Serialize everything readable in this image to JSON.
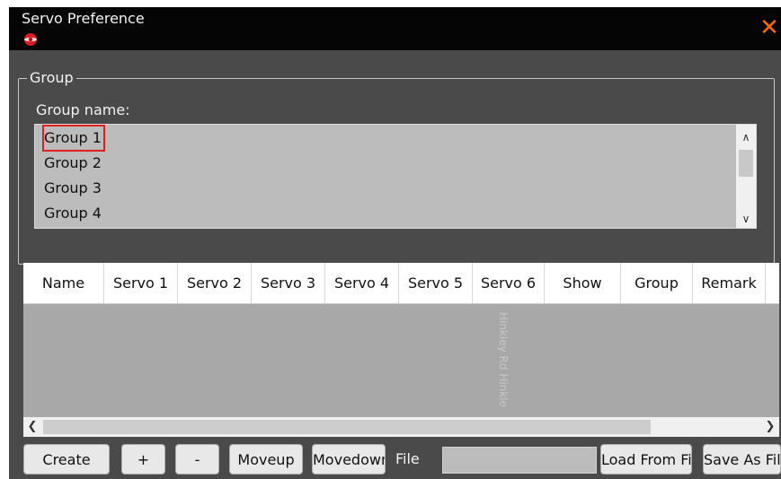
{
  "window": {
    "title": "Servo Preference",
    "close_glyph": "✕",
    "accent_color": "#ff6a00"
  },
  "group": {
    "legend": "Group",
    "name_label": "Group name:",
    "items": [
      "Group 1",
      "Group 2",
      "Group 3",
      "Group 4"
    ],
    "selected": "Group 1"
  },
  "table": {
    "columns": [
      "Name",
      "Servo 1",
      "Servo 2",
      "Servo 3",
      "Servo 4",
      "Servo 5",
      "Servo 6",
      "Show",
      "Group",
      "Remark"
    ]
  },
  "watermark": "Hinkley Rd   Hinkle",
  "toolbar": {
    "create": "Create",
    "plus": "+",
    "minus": "-",
    "moveup": "Moveup",
    "movedown": "Movedown",
    "file_label": "File",
    "file_value": "",
    "load_from_file": "Load From File",
    "save_as_file": "Save As File"
  },
  "icons": {
    "app": "app-logo-icon",
    "close": "close-icon",
    "scroll_up": "chevron-up-icon",
    "scroll_down": "chevron-down-icon",
    "scroll_left": "chevron-left-icon",
    "scroll_right": "chevron-right-icon"
  }
}
